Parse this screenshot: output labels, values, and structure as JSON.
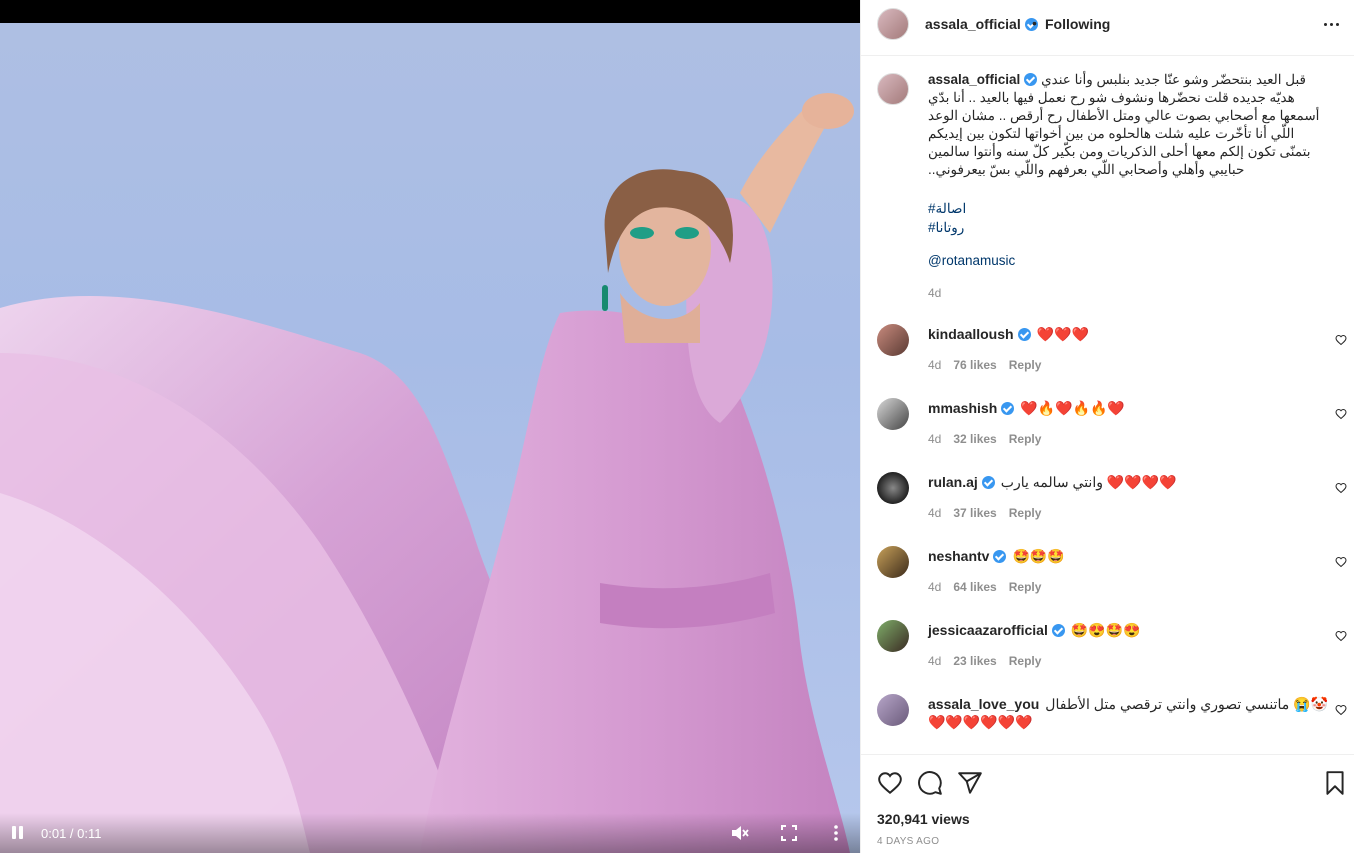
{
  "video": {
    "time": "0:01 / 0:11"
  },
  "header": {
    "username": "assala_official",
    "dot": "•",
    "follow_state": "Following"
  },
  "caption": {
    "username": "assala_official",
    "text": "قبل العيد بنتحضّر وشو عنّا جديد بنلبس وأنا عندي هديّه جديده قلت نحضّرها ونشوف شو رح نعمل فيها بالعيد .. أنا بدّي أسمعها مع أصحابي بصوت عالي ومتل الأطفال رح أرقص .. مشان الوعد اللّي أنا تأخّرت عليه شلت هالحلوه من بين أخواتها لتكون بين إيديكم بتمنّى تكون إلكم معها أحلى الذكريات ومن بكّير كلّ سنه وأنتوا سالمين حبايبي وأهلي وأصحابي اللّي بعرفهم واللّي بسّ بيعرفوني..",
    "tags": [
      "#اصالة",
      "#روتانا"
    ],
    "mention": "@rotanamusic",
    "time": "4d"
  },
  "comments": [
    {
      "username": "kindaalloush",
      "text": "❤️❤️❤️",
      "time": "4d",
      "likes": "76 likes",
      "reply": "Reply"
    },
    {
      "username": "mmashish",
      "text": "❤️🔥❤️🔥🔥❤️",
      "time": "4d",
      "likes": "32 likes",
      "reply": "Reply"
    },
    {
      "username": "rulan.aj",
      "text": "وانتي سالمه يارب ❤️❤️❤️❤️",
      "time": "4d",
      "likes": "37 likes",
      "reply": "Reply"
    },
    {
      "username": "neshantv",
      "text": "🤩🤩🤩",
      "time": "4d",
      "likes": "64 likes",
      "reply": "Reply"
    },
    {
      "username": "jessicaazarofficial",
      "text": "🤩😍🤩😍",
      "time": "4d",
      "likes": "23 likes",
      "reply": "Reply"
    },
    {
      "username": "assala_love_you",
      "text": "ماتنسي تصوري وانتي ترقصي متل الأطفال 😭🤡",
      "text2": "❤️❤️❤️❤️❤️❤️"
    }
  ],
  "footer": {
    "views": "320,941 views",
    "date": "4 DAYS AGO"
  },
  "colors": {
    "link": "#00376b",
    "verified": "#3897f0",
    "muted": "#8e8e8e",
    "dress": "#d9a7d6",
    "sky": "#aebfe3"
  },
  "icons": [
    "pause-icon",
    "mute-icon",
    "fullscreen-icon",
    "more-icon",
    "heart-icon",
    "comment-icon",
    "share-icon",
    "bookmark-icon",
    "verified-icon"
  ]
}
